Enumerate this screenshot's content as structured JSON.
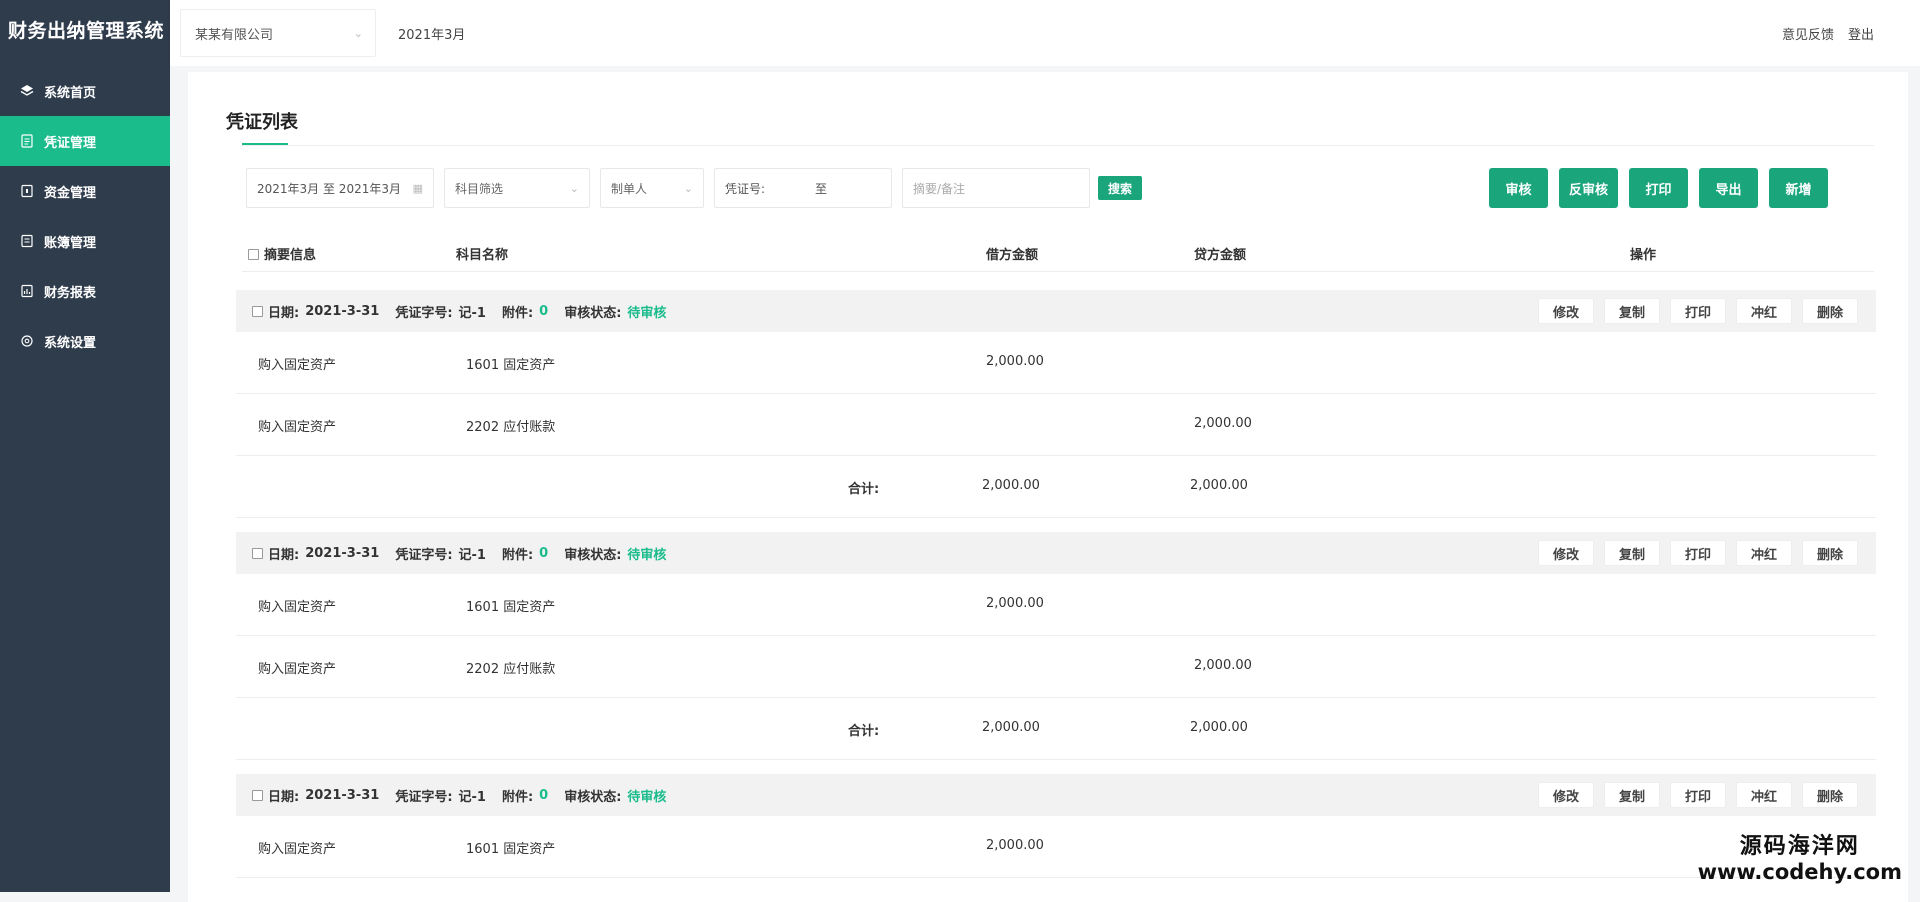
{
  "app": {
    "title": "财务出纳管理系统"
  },
  "sidebar": {
    "items": [
      {
        "label": "系统首页",
        "icon": "layers-icon",
        "active": false
      },
      {
        "label": "凭证管理",
        "icon": "document-icon",
        "active": true
      },
      {
        "label": "资金管理",
        "icon": "wallet-icon",
        "active": false
      },
      {
        "label": "账簿管理",
        "icon": "ledger-icon",
        "active": false
      },
      {
        "label": "财务报表",
        "icon": "report-icon",
        "active": false
      },
      {
        "label": "系统设置",
        "icon": "gear-icon",
        "active": false
      }
    ]
  },
  "header": {
    "company": "某某有限公司",
    "period": "2021年3月",
    "feedback": "意见反馈",
    "logout": "登出"
  },
  "page": {
    "title": "凭证列表"
  },
  "filters": {
    "date_range": "2021年3月 至 2021年3月",
    "subject_placeholder": "科目筛选",
    "maker_placeholder": "制单人",
    "voucher_no_label": "凭证号:",
    "voucher_no_to": "至",
    "memo_placeholder": "摘要/备注",
    "search": "搜索"
  },
  "actions": [
    "审核",
    "反审核",
    "打印",
    "导出",
    "新增"
  ],
  "table": {
    "headers": {
      "summary": "摘要信息",
      "subject": "科目名称",
      "debit": "借方金额",
      "credit": "贷方金额",
      "operation": "操作"
    }
  },
  "voucher_header_labels": {
    "date": "日期:",
    "voucher_no": "凭证字号:",
    "attachments": "附件:",
    "status": "审核状态:"
  },
  "row_ops": [
    "修改",
    "复制",
    "打印",
    "冲红",
    "删除"
  ],
  "vouchers": [
    {
      "date": "2021-3-31",
      "voucher_no": "记-1",
      "attachments": "0",
      "status": "待审核",
      "rows": [
        {
          "summary": "购入固定资产",
          "subject": "1601 固定资产",
          "debit": "2,000.00",
          "credit": ""
        },
        {
          "summary": "购入固定资产",
          "subject": "2202 应付账款",
          "debit": "",
          "credit": "2,000.00"
        }
      ],
      "total_label": "合计:",
      "total_debit": "2,000.00",
      "total_credit": "2,000.00"
    },
    {
      "date": "2021-3-31",
      "voucher_no": "记-1",
      "attachments": "0",
      "status": "待审核",
      "rows": [
        {
          "summary": "购入固定资产",
          "subject": "1601 固定资产",
          "debit": "2,000.00",
          "credit": ""
        },
        {
          "summary": "购入固定资产",
          "subject": "2202 应付账款",
          "debit": "",
          "credit": "2,000.00"
        }
      ],
      "total_label": "合计:",
      "total_debit": "2,000.00",
      "total_credit": "2,000.00"
    },
    {
      "date": "2021-3-31",
      "voucher_no": "记-1",
      "attachments": "0",
      "status": "待审核",
      "rows": [
        {
          "summary": "购入固定资产",
          "subject": "1601 固定资产",
          "debit": "2,000.00",
          "credit": ""
        }
      ]
    }
  ],
  "watermark": {
    "line1": "源码海洋网",
    "line2": "www.codehy.com"
  },
  "colors": {
    "sidebar": "#2f3c4c",
    "accent": "#1abc8c",
    "button": "#1aa57b"
  }
}
